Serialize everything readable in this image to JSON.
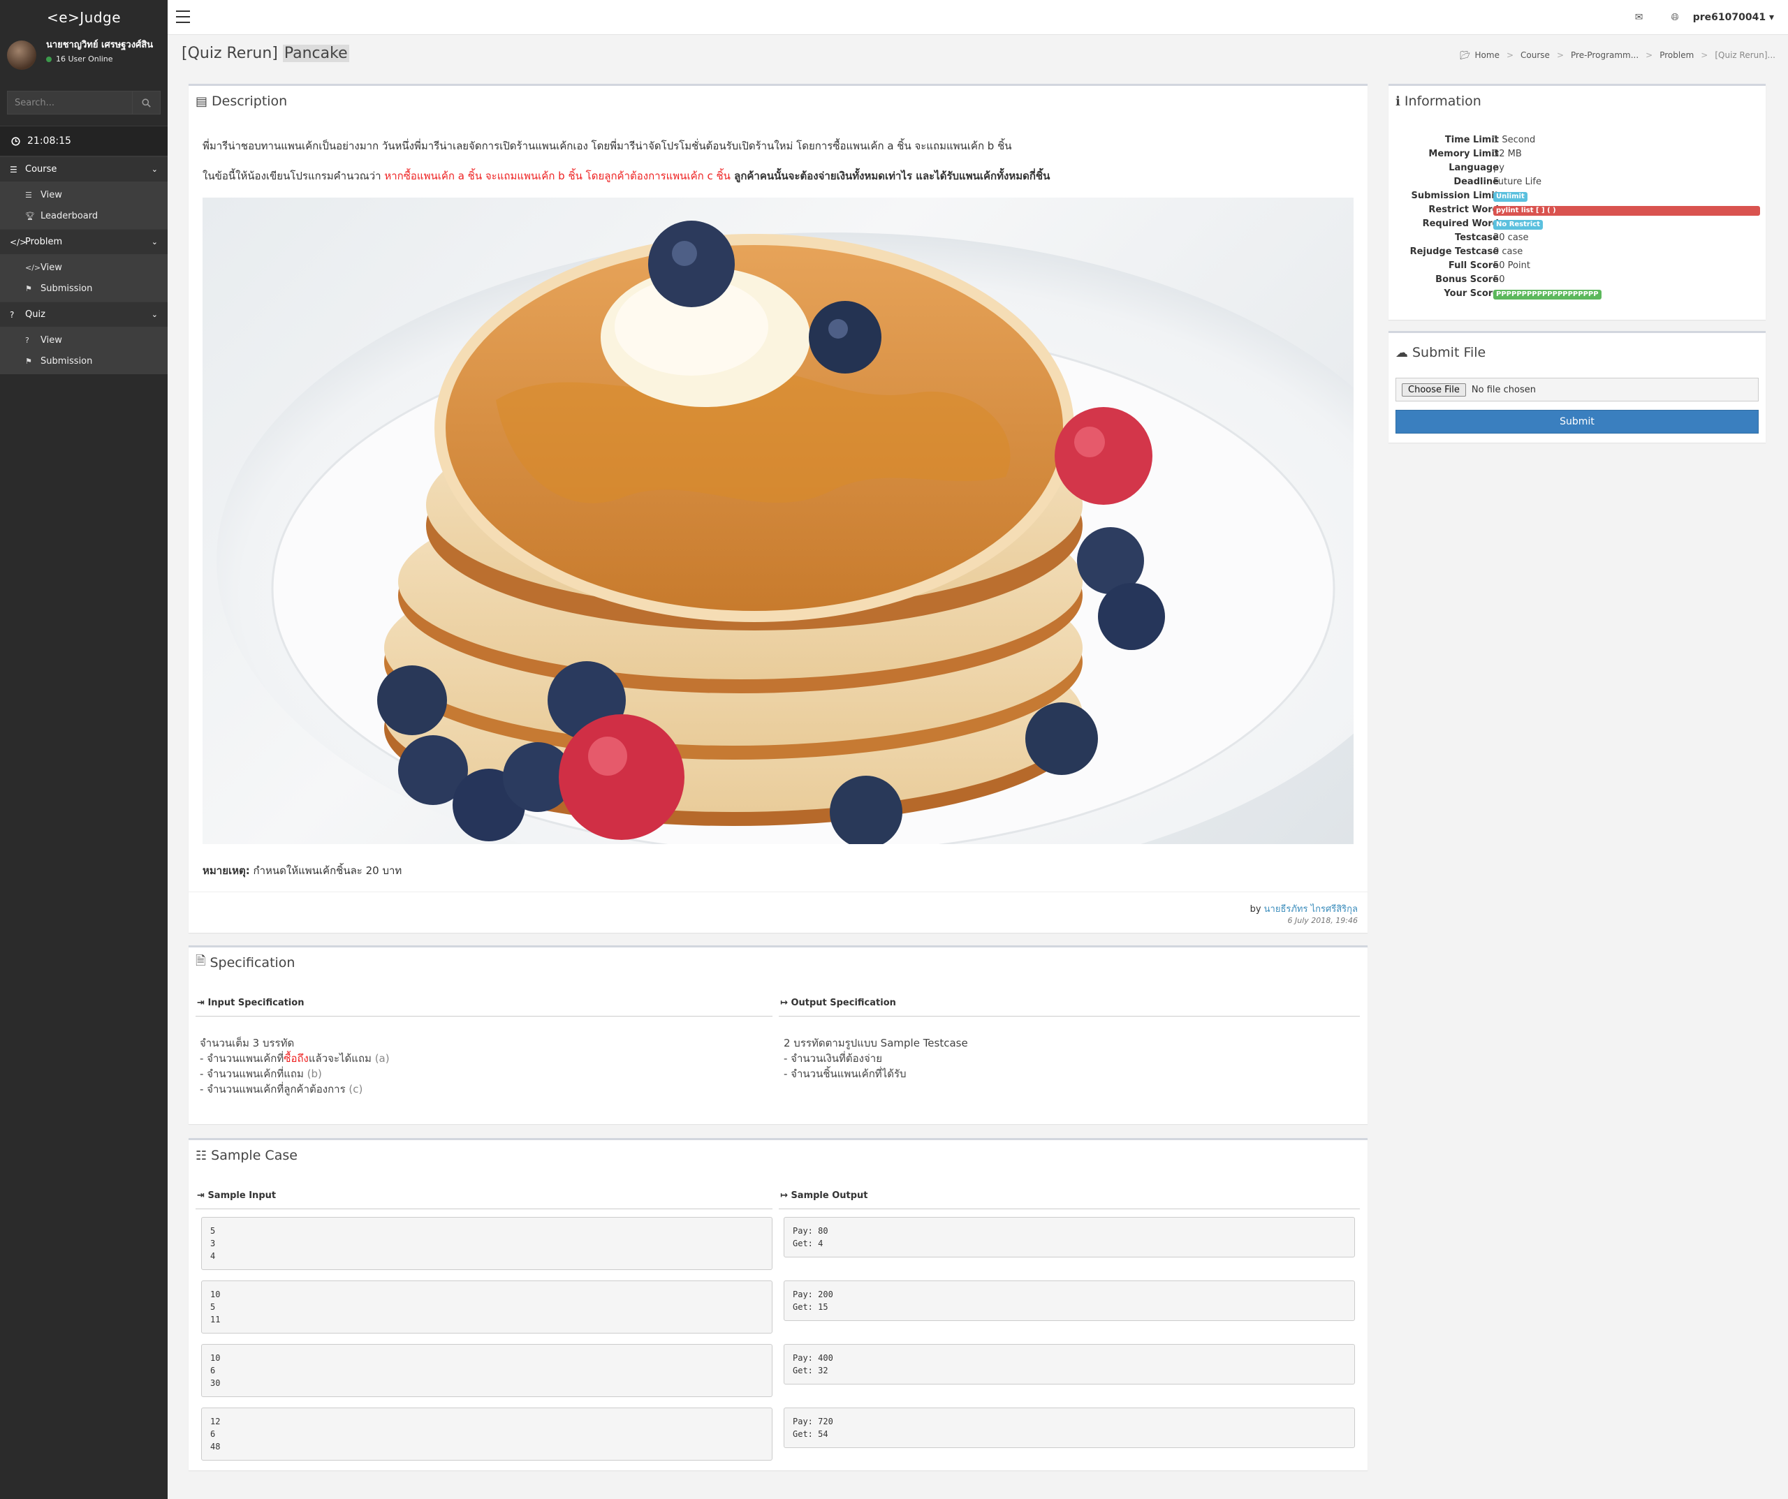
{
  "sidebar": {
    "brand": "<e>Judge",
    "user_name": "นายชาญวิทย์ เศรษฐวงศ์สิน",
    "user_online": "16 User Online",
    "search_placeholder": "Search...",
    "clock": "21:08:15",
    "groups": [
      {
        "label": "Course",
        "items": [
          {
            "label": "View"
          },
          {
            "label": "Leaderboard"
          }
        ]
      },
      {
        "label": "Problem",
        "items": [
          {
            "label": "View"
          },
          {
            "label": "Submission"
          }
        ]
      },
      {
        "label": "Quiz",
        "items": [
          {
            "label": "View"
          },
          {
            "label": "Submission"
          }
        ]
      }
    ]
  },
  "topbar": {
    "username": "pre61070041"
  },
  "page": {
    "title_prefix": "[Quiz Rerun]",
    "title_main": "Pancake",
    "breadcrumb": [
      "Home",
      "Course",
      "Pre-Programm...",
      "Problem",
      "[Quiz Rerun]..."
    ]
  },
  "description": {
    "header": "Description",
    "para1": "พี่มารีน่าชอบทานแพนเค้กเป็นอย่างมาก วันหนึ่งพี่มารีน่าเลยจัดการเปิดร้านแพนเค้กเอง โดยพี่มารีน่าจัดโปรโมชั่นต้อนรับเปิดร้านใหม่ โดยการซื้อแพนเค้ก a ชิ้น จะแถมแพนเค้ก b ชิ้น",
    "para2_a": "ในข้อนี้ให้น้องเขียนโปรแกรมคำนวณว่า ",
    "para2_red": "หากซื้อแพนเค้ก a ชิ้น จะแถมแพนเค้ก b ชิ้น โดยลูกค้าต้องการแพนเค้ก c ชิ้น",
    "para2_bold": " ลูกค้าคนนั้นจะต้องจ่ายเงินทั้งหมดเท่าไร และได้รับแพนเค้กทั้งหมดกี่ชิ้น",
    "note_label": "หมายเหตุ:",
    "note_text": " กำหนดให้แพนเค้กชิ้นละ 20 บาท",
    "by_prefix": "by ",
    "author": "นายธีรภัทร ไกรศรีสิริกุล",
    "date": "6 July 2018, 19:46"
  },
  "specification": {
    "header": "Specification",
    "input_label": "Input Specification",
    "output_label": "Output Specification",
    "input_lines": [
      {
        "text": "จำนวนเต็ม 3 บรรทัด"
      },
      {
        "pre": "- จำนวนแพนเค้กที่",
        "red": "ซื้อถึง",
        "post": "แล้วจะได้แถม ",
        "grey": "(a)"
      },
      {
        "pre": "- จำนวนแพนเค้กที่แถม ",
        "grey": "(b)"
      },
      {
        "pre": "- จำนวนแพนเค้กที่ลูกค้าต้องการ ",
        "grey": "(c)"
      }
    ],
    "output_lines": [
      "2 บรรทัดตามรูปแบบ Sample Testcase",
      "- จำนวนเงินที่ต้องจ่าย",
      "- จำนวนชิ้นแพนเค้กที่ได้รับ"
    ]
  },
  "sample": {
    "header": "Sample Case",
    "input_label": "Sample Input",
    "output_label": "Sample Output",
    "cases": [
      {
        "input": "5\n3\n4",
        "output": "Pay: 80\nGet: 4"
      },
      {
        "input": "10\n5\n11",
        "output": "Pay: 200\nGet: 15"
      },
      {
        "input": "10\n6\n30",
        "output": "Pay: 400\nGet: 32"
      },
      {
        "input": "12\n6\n48",
        "output": "Pay: 720\nGet: 54"
      }
    ]
  },
  "information": {
    "header": "Information",
    "rows": [
      {
        "label": "Time Limit",
        "value": "1 Second"
      },
      {
        "label": "Memory Limit",
        "value": "32 MB"
      },
      {
        "label": "Language",
        "value": "py"
      },
      {
        "label": "Deadline",
        "value": "Future Life"
      },
      {
        "label": "Submission Limit",
        "badge": "Unlimit",
        "badge_color": "#5bc0de"
      },
      {
        "label": "Restrict Word",
        "badge": "pylint list [ ] ( )",
        "badge_color": "#d9534f"
      },
      {
        "label": "Required Word",
        "badge": "No Restrict",
        "badge_color": "#5bc0de"
      },
      {
        "label": "Testcase",
        "value": "20 case"
      },
      {
        "label": "Rejudge Testcase",
        "value": "0 case"
      },
      {
        "label": "Full Score",
        "value": "50 Point"
      },
      {
        "label": "Bonus Score",
        "value": "50"
      },
      {
        "label": "Your Score",
        "badge": "PPPPPPPPPPPPPPPPPPPP",
        "badge_color": "#5cb85c"
      }
    ]
  },
  "submit_file": {
    "header": "Submit File",
    "choose_label": "Choose File",
    "no_file": "No file chosen",
    "submit_label": "Submit"
  }
}
